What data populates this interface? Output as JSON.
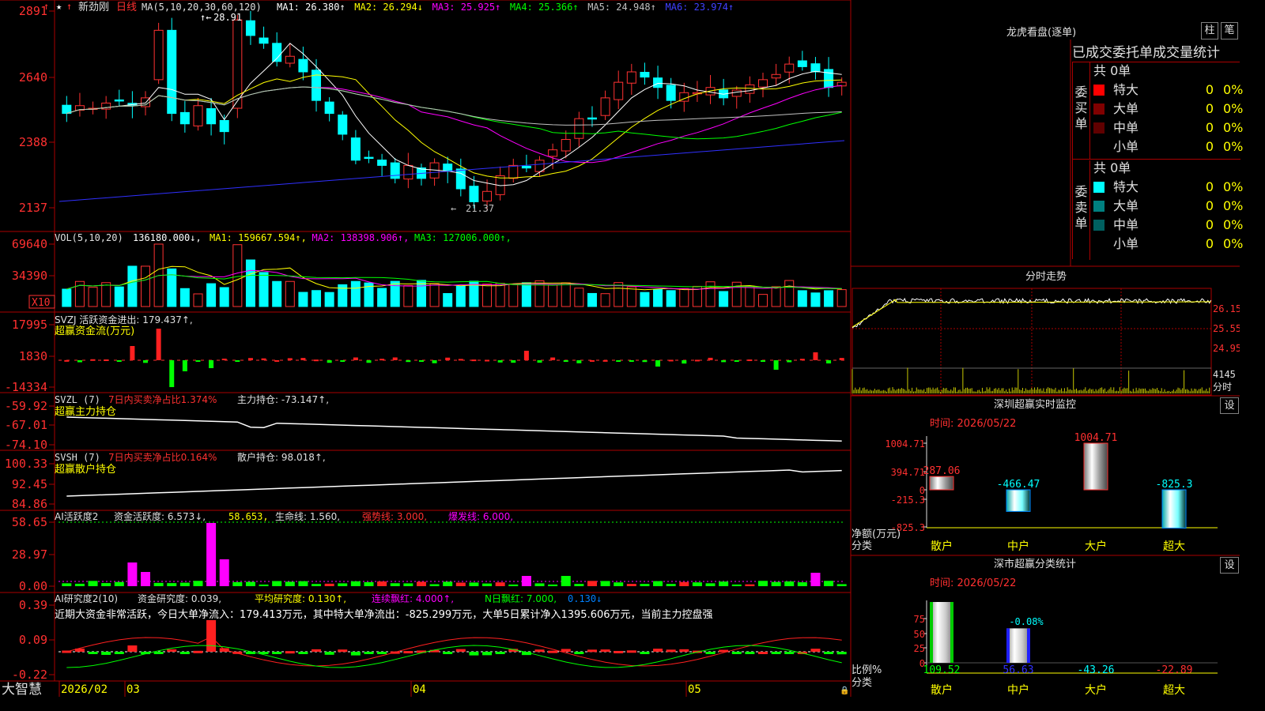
{
  "stock": {
    "name": "新劲刚",
    "period": "日线",
    "ma_label": "MA(5,10,20,30,60,120)",
    "ma_values": [
      {
        "label": "MA1:",
        "value": "26.380",
        "arrow": "↑",
        "color": "#ffffff"
      },
      {
        "label": "MA2:",
        "value": "26.294",
        "arrow": "↓",
        "color": "#ffff00"
      },
      {
        "label": "MA3:",
        "value": "25.925",
        "arrow": "↑",
        "color": "#ff00ff"
      },
      {
        "label": "MA4:",
        "value": "25.366",
        "arrow": "↑",
        "color": "#00ff00"
      },
      {
        "label": "MA5:",
        "value": "24.948",
        "arrow": "↑",
        "color": "#c0c0c0"
      },
      {
        "label": "MA6:",
        "value": "23.974",
        "arrow": "↑",
        "color": "#4040ff"
      }
    ],
    "price_axis": [
      "2891",
      "2640",
      "2388",
      "2137"
    ],
    "high_mark": "28.91",
    "low_mark": "21.37"
  },
  "vol": {
    "label": "VOL(5,10,20)",
    "value": "136180.000",
    "items": [
      {
        "t": "MA1: 159667.594",
        "color": "#ffff00"
      },
      {
        "t": "MA2: 138398.906",
        "color": "#ff00ff"
      },
      {
        "t": "MA3: 127006.000",
        "color": "#00ff00"
      }
    ],
    "axis": [
      "69640",
      "34390"
    ],
    "unit": "X10"
  },
  "svzj": {
    "label": "SVZJ  活跃资金进出: 179.437",
    "sub": "超赢资金流(万元)",
    "axis": [
      "17995",
      "1830",
      "-14334"
    ]
  },
  "svzl": {
    "label": "SVZL (7)",
    "ratio": "7日内买卖净占比1.374%",
    "hold": "主力持仓: -73.147",
    "sub": "超赢主力持仓",
    "axis": [
      "-59.92",
      "-67.01",
      "-74.10"
    ]
  },
  "svsh": {
    "label": "SVSH (7)",
    "ratio": "7日内买卖净占比0.164%",
    "hold": "散户持仓: 98.018",
    "sub": "超赢散户持仓",
    "axis": [
      "100.33",
      "92.45",
      "84.86"
    ]
  },
  "ai1": {
    "label": "AI活跃度2",
    "t1": "资金活跃度: 6.573",
    "t2": "58.653,",
    "t3": "生命线: 1.560,",
    "t4": "强势线: 3.000,",
    "t5": "爆发线: 6.000,",
    "axis": [
      "58.65",
      "28.97",
      "0.00"
    ]
  },
  "ai2": {
    "label": "AI研究度2(10)",
    "t1": "资金研究度: 0.039,",
    "t2": "平均研究度: 0.130",
    "t3": "连续飘红: 4.000",
    "t4": "N日飘红: 7.000,",
    "t5": "0.130",
    "comment": "近期大资金非常活跃，今日大单净流入：179.413万元，其中特大单净流出：-825.299万元，大单5日累计净入1395.606万元，当前主力控盘强",
    "axis": [
      "0.39",
      "0.09",
      "-0.22"
    ]
  },
  "date_axis": {
    "brand": "大智慧",
    "labels": [
      "2026/02",
      "03",
      "04",
      "05"
    ]
  },
  "longhu": {
    "title": "龙虎看盘(逐单)",
    "btn1": "柱",
    "btn2": "笔",
    "header": "已成交委托单成交量统计",
    "buy_title": "委买单",
    "sell_title": "委卖单",
    "buy_total": "共 0单",
    "sell_total": "共 0单",
    "buy_rows": [
      {
        "name": "特大",
        "count": "0",
        "pct": "0%",
        "color": "#ff0000"
      },
      {
        "name": "大单",
        "count": "0",
        "pct": "0%",
        "color": "#800000"
      },
      {
        "name": "中单",
        "count": "0",
        "pct": "0%",
        "color": "#600000"
      },
      {
        "name": "小单",
        "count": "0",
        "pct": "0%",
        "color": "#000000"
      }
    ],
    "sell_rows": [
      {
        "name": "特大",
        "count": "0",
        "pct": "0%",
        "color": "#00ffff"
      },
      {
        "name": "大单",
        "count": "0",
        "pct": "0%",
        "color": "#008080"
      },
      {
        "name": "中单",
        "count": "0",
        "pct": "0%",
        "color": "#006060"
      },
      {
        "name": "小单",
        "count": "0",
        "pct": "0%",
        "color": "#000000"
      }
    ]
  },
  "intraday": {
    "title": "分时走势",
    "axis": [
      "26.15",
      "25.55",
      "24.95"
    ],
    "vol_label": "4145",
    "vol_unit": "分时"
  },
  "monitor": {
    "title": "深圳超赢实时监控",
    "btn": "设",
    "time": "时间: 2026/05/22",
    "axis": [
      "1004.71",
      "394.71",
      "0",
      "-215.3",
      "-825.3"
    ],
    "ylabel": "净额(万元)",
    "xlabel": "分类",
    "bars": [
      {
        "cat": "散户",
        "value": 287.06,
        "label": "287.06"
      },
      {
        "cat": "中户",
        "value": -466.47,
        "label": "-466.47"
      },
      {
        "cat": "大户",
        "value": 1004.71,
        "label": "1004.71"
      },
      {
        "cat": "超大",
        "value": -825.3,
        "label": "-825.3"
      }
    ]
  },
  "classify": {
    "title": "深市超赢分类统计",
    "btn": "设",
    "time": "时间: 2026/05/22",
    "axis": [
      "75",
      "50",
      "25",
      "0"
    ],
    "ylabel": "比例%",
    "xlabel": "分类",
    "bars": [
      {
        "cat": "散户",
        "value": 109.52,
        "label": "109.52"
      },
      {
        "cat": "中户",
        "value": 56.63,
        "label": "56.63"
      },
      {
        "cat": "大户",
        "value": -43.26,
        "label": "-43.26"
      },
      {
        "cat": "超大",
        "value": -22.89,
        "label": "-22.89"
      }
    ],
    "mid_note": "-0.08%"
  }
}
